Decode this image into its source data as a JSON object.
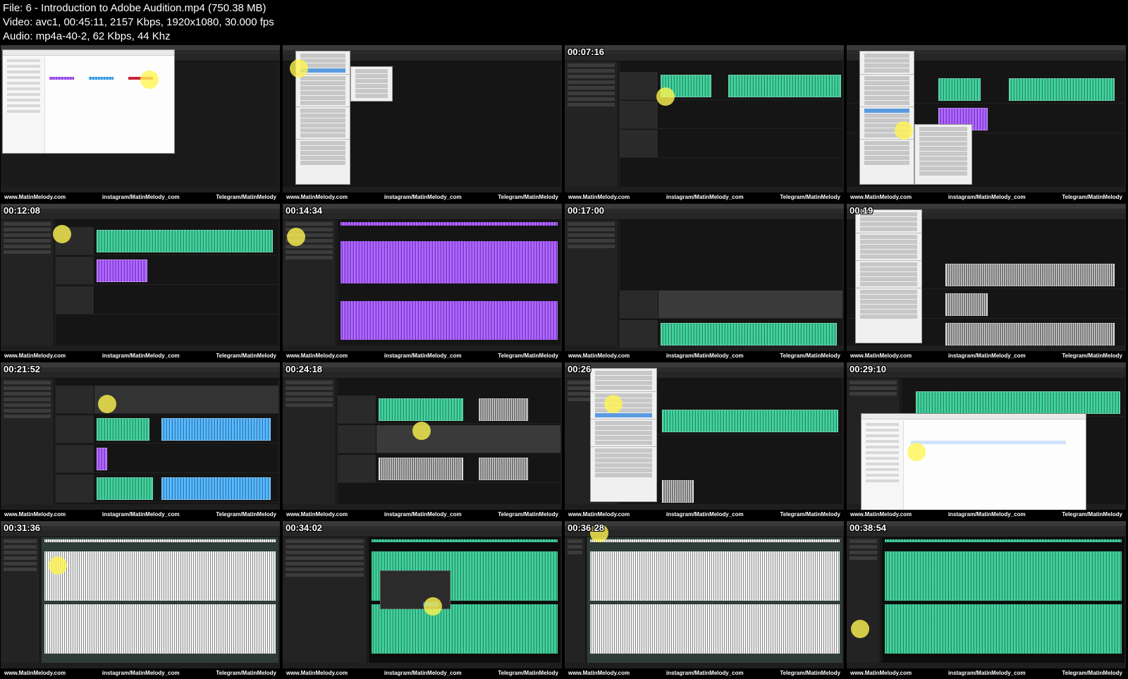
{
  "header": {
    "file_line": "File: 6 - Introduction to Adobe Audition.mp4 (750.38 MB)",
    "video_line": "Video: avc1, 00:45:11, 2157 Kbps, 1920x1080, 30.000 fps",
    "audio_line": "Audio: mp4a-40-2, 62 Kbps, 44 Khz"
  },
  "watermark": {
    "website": "www.MatinMelody.com",
    "instagram": "instagram/MatinMelody_com",
    "telegram": "Telegram/MatinMelody"
  },
  "frames": [
    {
      "timestamp": "",
      "scene": "file-dialog"
    },
    {
      "timestamp": "",
      "scene": "edit-menu"
    },
    {
      "timestamp": "00:07:16",
      "scene": "multitrack-green"
    },
    {
      "timestamp": "",
      "scene": "select-menu"
    },
    {
      "timestamp": "00:12:08",
      "scene": "multitrack-green-purple"
    },
    {
      "timestamp": "00:14:34",
      "scene": "purple-waveform"
    },
    {
      "timestamp": "00:17:00",
      "scene": "multitrack-empty"
    },
    {
      "timestamp": "00:19",
      "scene": "clip-menu-gray"
    },
    {
      "timestamp": "00:21:52",
      "scene": "multitrack-blue"
    },
    {
      "timestamp": "00:24:18",
      "scene": "multitrack-gray"
    },
    {
      "timestamp": "00:26",
      "scene": "clip-menu"
    },
    {
      "timestamp": "00:29:10",
      "scene": "explorer-dialog"
    },
    {
      "timestamp": "00:31:36",
      "scene": "waveform-white-green"
    },
    {
      "timestamp": "00:34:02",
      "scene": "waveform-dialog"
    },
    {
      "timestamp": "00:36:28",
      "scene": "waveform-white"
    },
    {
      "timestamp": "00:38:54",
      "scene": "waveform-green"
    }
  ]
}
